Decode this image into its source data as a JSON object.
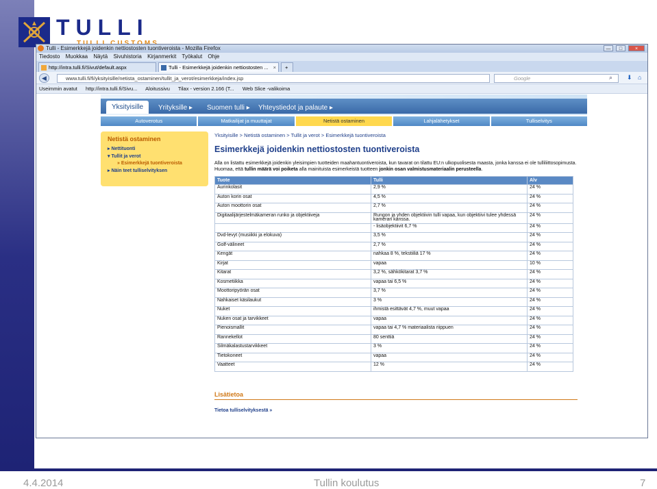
{
  "slide": {
    "logo_main": "TULLI",
    "logo_sub": "TULLI CUSTOMS",
    "date": "4.4.2014",
    "footer_title": "Tullin koulutus",
    "page_number": "7"
  },
  "window": {
    "title": "Tulli - Esimerkkejä joidenkin nettiostosten tuontiveroista - Mozilla Firefox",
    "minimize": "—",
    "maximize": "□",
    "close": "×"
  },
  "menu": [
    "Tiedosto",
    "Muokkaa",
    "Näytä",
    "Sivuhistoria",
    "Kirjanmerkit",
    "Työkalut",
    "Ohje"
  ],
  "tabs": [
    {
      "label": "http://intra.tulli.fi/Sivut/default.aspx"
    },
    {
      "label": "Tulli - Esimerkkejä joidenkin nettiostosten ..."
    }
  ],
  "new_tab": "+",
  "nav": {
    "url": "www.tulli.fi/fi/yksityisille/netista_ostaminen/tullit_ja_verot/esimerkkeja/index.jsp",
    "search_placeholder": "Google"
  },
  "bookmarks": [
    "Useimmin avatut",
    "http://intra.tulli.fi/Sivu...",
    "Aloitussivu",
    "Tilax - version 2.166 (T...",
    "Web Slice -valikoima"
  ],
  "site": {
    "topnav": [
      "Yksityisille",
      "Yrityksille ▸",
      "Suomen tulli ▸",
      "Yhteystiedot ja palaute ▸"
    ],
    "subnav": [
      "Autoverotus",
      "Matkailijat ja muuttajat",
      "Netistä ostaminen",
      "Lahjalähetykset",
      "Tulliselvitys"
    ],
    "left": {
      "title": "Netistä ostaminen",
      "items": [
        "▸ Nettituonti",
        "▾ Tullit ja verot",
        "» Esimerkkejä tuontiveroista",
        "▸ Näin teet tulliselvityksen"
      ]
    },
    "breadcrumb": "Yksityisille > Netistä ostaminen > Tullit ja verot > Esimerkkejä tuontiveroista",
    "heading": "Esimerkkejä joidenkin nettiostosten tuontiveroista",
    "intro_a": "Alla on listattu esimerkkejä joidenkin yleisimpien tuotteiden maahantuontiveroista, kun tavarat on tilattu EU:n ulkopuolisesta maasta, jonka kanssa ei ole tulliliittosopimusta. Huomaa, että ",
    "intro_b": "tullin määrä voi poiketa",
    "intro_c": " alla mainituista esimerkeistä tuotteen ",
    "intro_d": "jonkin osan valmistusmateriaalin perusteella",
    "intro_e": ".",
    "table": {
      "headers": [
        "Tuote",
        "Tulli",
        "Alv"
      ],
      "rows": [
        [
          "Aurinkolasit",
          "2,9 %",
          "24 %"
        ],
        [
          "Auton korin osat",
          "4,5 %",
          "24 %"
        ],
        [
          "Auton moottorin osat",
          "2,7 %",
          "24 %"
        ],
        [
          "Digitaalijärjestelmäkameran runko ja objektiiveja",
          "Rungon ja yhden objektiivin tulli vapaa, kun objektiivi tulee yhdessä kameran kanssa.",
          "24 %"
        ],
        [
          "",
          "- lisäobjektiivit 6,7 %",
          "24 %"
        ],
        [
          "Dvd-levyt (musiikki ja elokuva)",
          "3,5 %",
          "24 %"
        ],
        [
          "Golf-välineet",
          "2,7 %",
          "24 %"
        ],
        [
          "Kengät",
          "nahkaa 8 %, tekstiiliä 17 %",
          "24 %"
        ],
        [
          "Kirjat",
          "vapaa",
          "10 %"
        ],
        [
          "Kitarat",
          "3,2 %, sähkökitarat 3,7 %",
          "24 %"
        ],
        [
          "Kosmetiikka",
          "vapaa tai 6,5 %",
          "24 %"
        ],
        [
          "Moottoripyörän osat",
          "3,7 %",
          "24 %"
        ],
        [
          "Nahkaiset käsilaukut",
          "3 %",
          "24 %"
        ],
        [
          "Nuket",
          "ihmistä esittävät 4,7 %, muut vapaa",
          "24 %"
        ],
        [
          "Nuken osat ja tarvikkeet",
          "vapaa",
          "24 %"
        ],
        [
          "Pienoismallit",
          "vapaa tai 4,7 % materiaalista riippuen",
          "24 %"
        ],
        [
          "Rannekellot",
          "80 senttiä",
          "24 %"
        ],
        [
          "Silmäkalastustarvikkeet",
          "3 %",
          "24 %"
        ],
        [
          "Tietokoneet",
          "vapaa",
          "24 %"
        ],
        [
          "Vaatteet",
          "12 %",
          "24 %"
        ]
      ]
    },
    "more_heading": "Lisätietoa",
    "more_link": "Tietoa tulliselvityksestä »"
  }
}
